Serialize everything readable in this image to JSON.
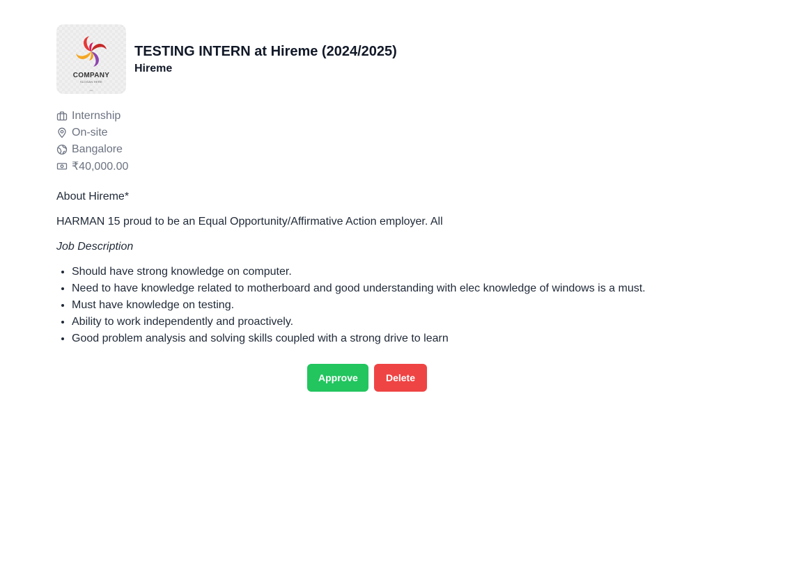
{
  "job": {
    "title": "TESTING INTERN at Hireme (2024/2025)",
    "company": "Hireme",
    "logo": {
      "name": "COMPANY",
      "slogan": "SLOGAN HERE"
    }
  },
  "meta": {
    "type": "Internship",
    "mode": "On-site",
    "location": "Bangalore",
    "salary": "₹40,000.00"
  },
  "details": {
    "about": "About Hireme*",
    "intro": "HARMAN 15 proud to be an Equal Opportunity/Affirmative Action employer. All",
    "description_heading": "Job Description",
    "bullets": [
      "Should have strong knowledge on computer.",
      "Need to have knowledge related to motherboard and good understanding with elec knowledge of windows is a must.",
      "Must have knowledge on testing.",
      "Ability to work independently and proactively.",
      "Good problem analysis and solving skills coupled with a strong drive to learn"
    ]
  },
  "actions": {
    "approve_label": "Approve",
    "delete_label": "Delete"
  },
  "icons": {
    "type": "briefcase-icon",
    "mode": "map-pin-icon",
    "location": "globe-icon",
    "salary": "banknote-icon"
  },
  "colors": {
    "approve": "#22c55e",
    "delete": "#ef4444",
    "meta_text": "#6b7280"
  }
}
